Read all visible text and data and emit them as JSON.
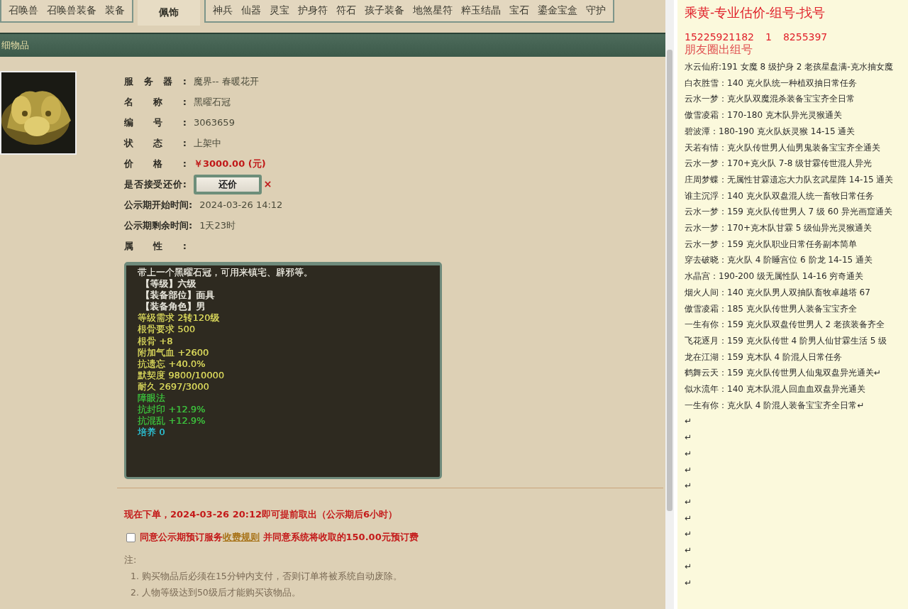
{
  "tab_groups": [
    {
      "tabs": [
        {
          "label": "召唤兽",
          "selected": false
        },
        {
          "label": "召唤兽装备",
          "selected": false
        },
        {
          "label": "装备",
          "selected": false
        }
      ]
    },
    {
      "tabs": [
        {
          "label": "佩饰",
          "selected": true
        }
      ]
    },
    {
      "tabs": [
        {
          "label": "神兵",
          "selected": false
        },
        {
          "label": "仙器",
          "selected": false
        },
        {
          "label": "灵宝",
          "selected": false
        },
        {
          "label": "护身符",
          "selected": false
        },
        {
          "label": "符石",
          "selected": false
        },
        {
          "label": "孩子装备",
          "selected": false
        },
        {
          "label": "地煞星符",
          "selected": false
        },
        {
          "label": "粹玉结晶",
          "selected": false
        },
        {
          "label": "宝石",
          "selected": false
        },
        {
          "label": "鎏金宝盒",
          "selected": false
        },
        {
          "label": "守护",
          "selected": false
        }
      ]
    }
  ],
  "section_title": "细物品",
  "item": {
    "fields": [
      {
        "kind": "plain",
        "label": "服务器:",
        "value": "魔界-- 春暖花开"
      },
      {
        "kind": "plain",
        "label": "名称:",
        "value": "黑曜石冠"
      },
      {
        "kind": "plain",
        "label": "编号:",
        "value": "3063659"
      },
      {
        "kind": "plain",
        "label": "状态:",
        "value": "上架中"
      },
      {
        "kind": "price",
        "label": "价格:",
        "value": "￥3000.00 (元)"
      },
      {
        "kind": "button",
        "label": "是否接受还价:",
        "value": "还价"
      },
      {
        "kind": "plain",
        "label": "公示期开始时间:",
        "value": "2024-03-26 14:12"
      },
      {
        "kind": "plain",
        "label": "公示期剩余时间:",
        "value": "1天23时"
      },
      {
        "kind": "plain",
        "label": "属性:"
      }
    ],
    "attributes": [
      {
        "text": "带上一个黑曜石冠，可用来镇宅、辟邪等。",
        "color": "#e6e4da"
      },
      {
        "text": " 【等级】六级",
        "color": "#e6e4da"
      },
      {
        "text": " 【装备部位】面具",
        "color": "#e6e4da"
      },
      {
        "text": " 【装备角色】男",
        "color": "#e6e4da"
      },
      {
        "text": "等级需求 2转120级",
        "color": "#d6d45a"
      },
      {
        "text": "根骨要求 500",
        "color": "#d6d45a"
      },
      {
        "text": "根骨 +8",
        "color": "#d6d45a"
      },
      {
        "text": "附加气血 +2600",
        "color": "#d6d45a"
      },
      {
        "text": "抗遗忘 +40.0%",
        "color": "#d6d45a"
      },
      {
        "text": "默契度 9800/10000",
        "color": "#d6d45a"
      },
      {
        "text": "耐久 2697/3000",
        "color": "#d6d45a"
      },
      {
        "text": "障眼法",
        "color": "#3cbe3c"
      },
      {
        "text": "抗封印 +12.9%",
        "color": "#3cbe3c"
      },
      {
        "text": "抗混乱 +12.9%",
        "color": "#3cbe3c"
      },
      {
        "text": "培养 0",
        "color": "#2cc0d2"
      }
    ]
  },
  "order_notice": "现在下单，2024-03-26 20:12即可提前取出（公示期后6小时）",
  "agreement": {
    "checked": false,
    "before": "同意公示期预订服务",
    "link": "收费规则",
    "after": " 并同意系统将收取的150.00元预订费"
  },
  "notes": {
    "title": "注:",
    "items": [
      "1. 购买物品后必须在15分钟内支付，否则订单将被系统自动废除。",
      "2. 人物等级达到50级后才能购买该物品。"
    ]
  },
  "document": {
    "title": "乘黄-专业估价-组号-找号",
    "phones": [
      "15225921182",
      "1",
      "8255397"
    ],
    "subtitle": "朋友圈出组号",
    "lines": [
      "水云仙府:191 女魔 8 级护身 2 老孩星盘满-克水抽女魔",
      "白衣胜雪：140 克火队统一种植双抽日常任务",
      "云水一梦：克火队双魔混杀装备宝宝齐全日常",
      "傲雪凌霜：170-180 克木队异光灵猴通关",
      "碧波潭：180-190 克火队妖灵猴 14-15 通关",
      "天若有情：克火队传世男人仙男鬼装备宝宝齐全通关",
      "云水一梦：170+克火队 7-8 级甘霖传世混人异光",
      "庄周梦蝶：无属性甘霖遗忘大力队玄武星阵 14-15 通关",
      "谁主沉浮：140 克火队双盘混人统一畜牧日常任务",
      "云水一梦：159 克火队传世男人 7 级 60 异光画窟通关",
      "云水一梦：170+克木队甘霖 5 级仙异光灵猴通关",
      "云水一梦：159 克火队职业日常任务副本简单",
      "穿去破晓：克火队 4 阶睡宫位 6 阶龙 14-15 通关",
      "水晶宫：190-200 级无属性队 14-16 穷奇通关",
      "烟火人间：140 克火队男人双抽队畜牧卓越塔 67",
      "傲雪凌霜：185 克火队传世男人装备宝宝齐全",
      "一生有你：159 克火队双盘传世男人 2 老孩装备齐全",
      "飞花逐月：159 克火队传世 4 阶男人仙甘霖生活 5 级",
      "龙在江湖：159 克木队 4 阶混人日常任务",
      "鹤舞云天：159 克火队传世男人仙鬼双盘异光通关↵",
      "似水流年：140 克木队混人回血血双盘异光通关",
      "一生有你：克火队 4 阶混人装备宝宝齐全日常↵",
      "↵",
      "↵",
      "↵",
      "↵",
      "↵",
      "↵",
      "↵",
      "↵",
      "↵",
      "↵",
      "↵"
    ]
  }
}
